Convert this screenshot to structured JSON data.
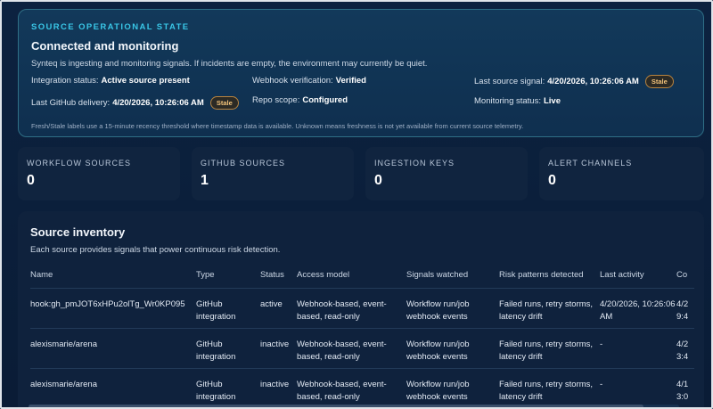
{
  "state": {
    "eyebrow": "SOURCE OPERATIONAL STATE",
    "title": "Connected and monitoring",
    "description": "Synteq is ingesting and monitoring signals. If incidents are empty, the environment may currently be quiet.",
    "integration_label": "Integration status:",
    "integration_value": "Active source present",
    "webhook_label": "Webhook verification:",
    "webhook_value": "Verified",
    "last_signal_label": "Last source signal:",
    "last_signal_value": "4/20/2026, 10:26:06 AM",
    "last_signal_badge": "Stale",
    "github_label": "Last GitHub delivery:",
    "github_value": "4/20/2026, 10:26:06 AM",
    "github_badge": "Stale",
    "repo_label": "Repo scope:",
    "repo_value": "Configured",
    "monitoring_label": "Monitoring status:",
    "monitoring_value": "Live",
    "footnote": "Fresh/Stale labels use a 15-minute recency threshold where timestamp data is available. Unknown means freshness is not yet available from current source telemetry."
  },
  "metrics": [
    {
      "label": "WORKFLOW SOURCES",
      "value": "0"
    },
    {
      "label": "GITHUB SOURCES",
      "value": "1"
    },
    {
      "label": "INGESTION KEYS",
      "value": "0"
    },
    {
      "label": "ALERT CHANNELS",
      "value": "0"
    }
  ],
  "inventory": {
    "title": "Source inventory",
    "description": "Each source provides signals that power continuous risk detection.",
    "columns": [
      "Name",
      "Type",
      "Status",
      "Access model",
      "Signals watched",
      "Risk patterns detected",
      "Last activity",
      "Co"
    ],
    "rows": [
      [
        "hook:gh_pmJOT6xHPu2olTg_Wr0KP095",
        "GitHub integration",
        "active",
        "Webhook-based, event-based, read-only",
        "Workflow run/job webhook events",
        "Failed runs, retry storms, latency drift",
        "4/20/2026, 10:26:06 AM",
        "4/2 9:4"
      ],
      [
        "alexismarie/arena",
        "GitHub integration",
        "inactive",
        "Webhook-based, event-based, read-only",
        "Workflow run/job webhook events",
        "Failed runs, retry storms, latency drift",
        "-",
        "4/2 3:4"
      ],
      [
        "alexismarie/arena",
        "GitHub integration",
        "inactive",
        "Webhook-based, event-based, read-only",
        "Workflow run/job webhook events",
        "Failed runs, retry storms, latency drift",
        "-",
        "4/1 3:0"
      ]
    ]
  }
}
